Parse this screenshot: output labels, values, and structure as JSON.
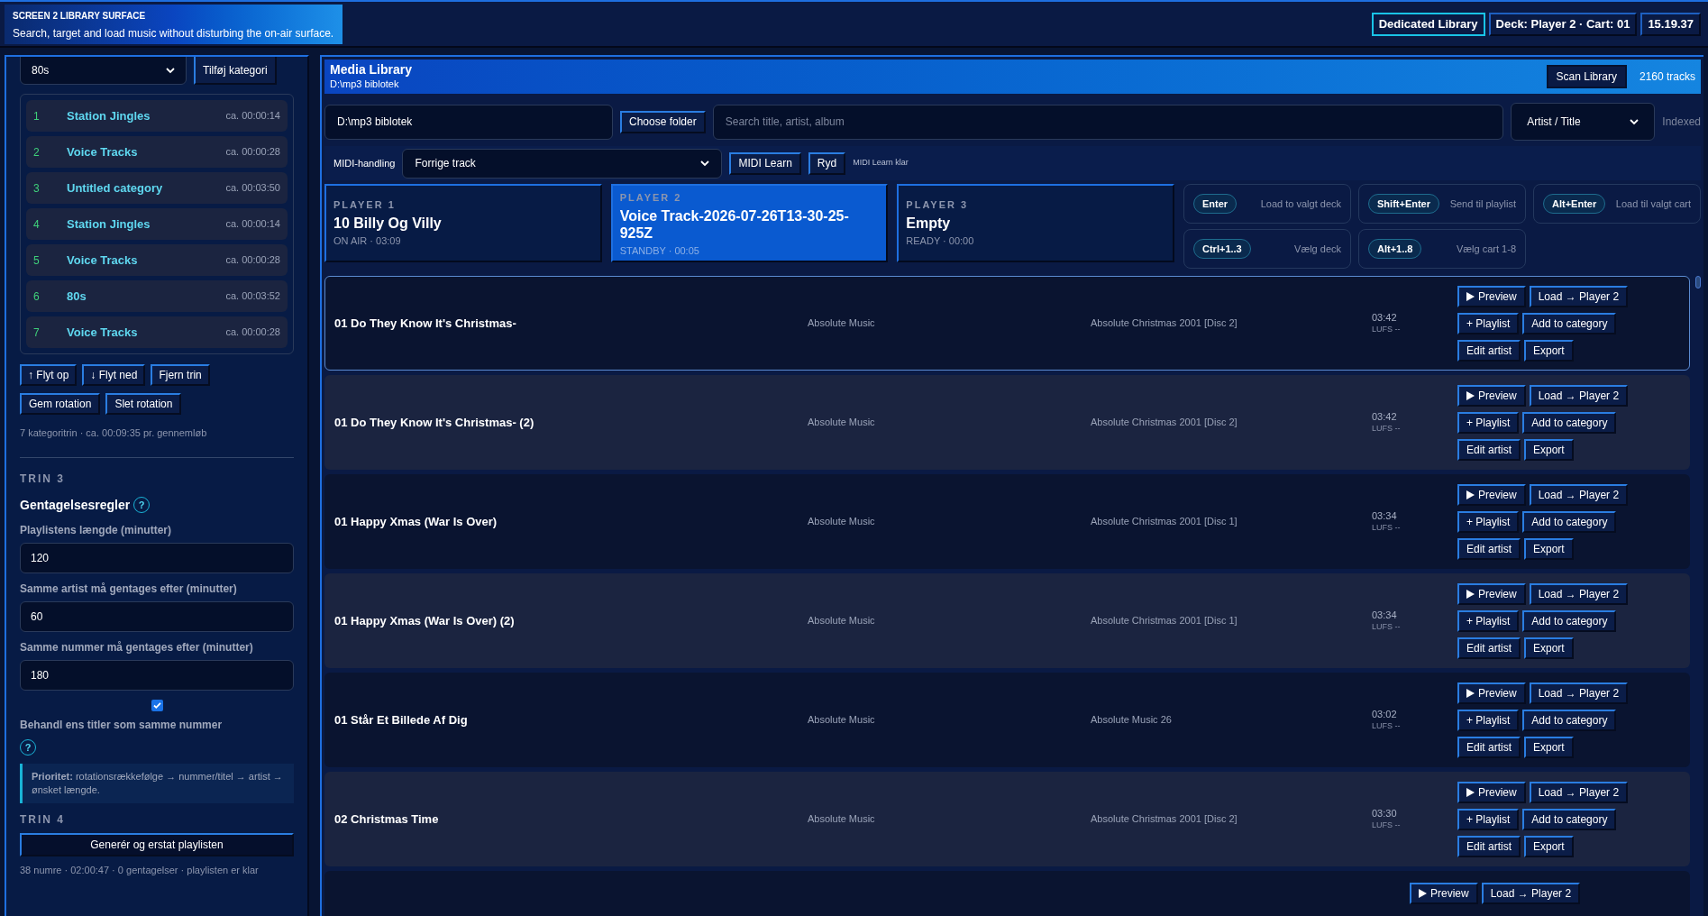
{
  "header": {
    "label": "SCREEN 2 LIBRARY SURFACE",
    "subtitle": "Search, target and load music without disturbing the on-air surface."
  },
  "badges": [
    {
      "text": "Dedicated Library",
      "kind": "accent"
    },
    {
      "text": "Deck: Player 2 · Cart: 01",
      "kind": "plain"
    },
    {
      "text": "15.19.37",
      "kind": "plain"
    }
  ],
  "sidebar": {
    "category_select": "80s",
    "add_category": "Tilføj kategori",
    "rotation": [
      {
        "number": "1",
        "name": "Station Jingles",
        "duration": "ca. 00:00:14"
      },
      {
        "number": "2",
        "name": "Voice Tracks",
        "duration": "ca. 00:00:28"
      },
      {
        "number": "3",
        "name": "Untitled category",
        "duration": "ca. 00:03:50"
      },
      {
        "number": "4",
        "name": "Station Jingles",
        "duration": "ca. 00:00:14"
      },
      {
        "number": "5",
        "name": "Voice Tracks",
        "duration": "ca. 00:00:28"
      },
      {
        "number": "6",
        "name": "80s",
        "duration": "ca. 00:03:52"
      },
      {
        "number": "7",
        "name": "Voice Tracks",
        "duration": "ca. 00:00:28"
      }
    ],
    "step_buttons": [
      "↑ Flyt op",
      "↓ Flyt ned",
      "Fjern trin"
    ],
    "rotation_buttons": [
      "Gem rotation",
      "Slet rotation"
    ],
    "summary": "7 kategoritrin · ca. 00:09:35 pr. gennemløb",
    "step3": "TRIN 3",
    "rules_heading": "Gentagelsesregler",
    "help": "?",
    "fields": [
      {
        "label": "Playlistens længde (minutter)",
        "value": "120"
      },
      {
        "label": "Samme artist må gentages efter (minutter)",
        "value": "60"
      },
      {
        "label": "Samme nummer må gentages efter (minutter)",
        "value": "180"
      }
    ],
    "same_titles": {
      "checked": true,
      "label": "Behandl ens titler som samme nummer",
      "help": "?"
    },
    "priority": "**Prioritet:** rotationsrækkefølge → nummer/titel → artist → ønsket længde.",
    "step4": "TRIN 4",
    "generate": "Generér og erstat playlisten",
    "result": "38 numre · 02:00:47 · 0 gentagelser · playlisten er klar"
  },
  "library": {
    "title": "Media Library",
    "path": "D:\\mp3 biblotek",
    "scan": "Scan Library",
    "count": "2160 tracks",
    "folder": "D:\\mp3 biblotek",
    "choose_folder": "Choose folder",
    "search_placeholder": "Search title, artist, album",
    "sort": "Artist / Title",
    "indexed": "Indexed",
    "midi_label": "MIDI-handling",
    "midi_action": "Forrige track",
    "midi_learn": "MIDI Learn",
    "midi_clear": "Ryd",
    "midi_status": "MIDI Learn klar",
    "players": [
      {
        "label": "PLAYER 1",
        "title": "10 Billy Og Villy",
        "status": "ON AIR · 03:09",
        "selected": false
      },
      {
        "label": "PLAYER 2",
        "title": "Voice Track-2026-07-26T13-30-25-925Z",
        "status": "STANDBY · 00:05",
        "selected": true
      },
      {
        "label": "PLAYER 3",
        "title": "Empty",
        "status": "READY · 00:00",
        "selected": false
      }
    ],
    "shortcuts": [
      {
        "key": "Enter",
        "text": "Load to valgt deck"
      },
      {
        "key": "Shift+Enter",
        "text": "Send til playlist"
      },
      {
        "key": "Alt+Enter",
        "text": "Load til valgt cart"
      },
      {
        "key": "Ctrl+1..3",
        "text": "Vælg deck"
      },
      {
        "key": "Alt+1..8",
        "text": "Vælg cart 1-8"
      }
    ],
    "tracks": [
      {
        "kind": "track",
        "selected": true,
        "title": "01 Do They Know It's Christmas-",
        "artist": "Absolute Music",
        "album": "Absolute Christmas 2001 [Disc 2]",
        "duration": "03:42",
        "lufs": "LUFS --",
        "actions": [
          "Preview",
          "Load → Player 2",
          "+ Playlist",
          "Add to category",
          "Edit artist",
          "Export"
        ]
      },
      {
        "kind": "track",
        "selected": false,
        "title": "01 Do They Know It's Christmas- (2)",
        "artist": "Absolute Music",
        "album": "Absolute Christmas 2001 [Disc 2]",
        "duration": "03:42",
        "lufs": "LUFS --",
        "actions": [
          "Preview",
          "Load → Player 2",
          "+ Playlist",
          "Add to category",
          "Edit artist",
          "Export"
        ]
      },
      {
        "kind": "track",
        "selected": false,
        "title": "01 Happy Xmas (War Is Over)",
        "artist": "Absolute Music",
        "album": "Absolute Christmas 2001 [Disc 1]",
        "duration": "03:34",
        "lufs": "LUFS --",
        "actions": [
          "Preview",
          "Load → Player 2",
          "+ Playlist",
          "Add to category",
          "Edit artist",
          "Export"
        ]
      },
      {
        "kind": "track",
        "selected": false,
        "title": "01 Happy Xmas (War Is Over) (2)",
        "artist": "Absolute Music",
        "album": "Absolute Christmas 2001 [Disc 1]",
        "duration": "03:34",
        "lufs": "LUFS --",
        "actions": [
          "Preview",
          "Load → Player 2",
          "+ Playlist",
          "Add to category",
          "Edit artist",
          "Export"
        ]
      },
      {
        "kind": "track",
        "selected": false,
        "title": "01 Står Et Billede Af Dig",
        "artist": "Absolute Music",
        "album": "Absolute Music 26",
        "duration": "03:02",
        "lufs": "LUFS --",
        "actions": [
          "Preview",
          "Load → Player 2",
          "+ Playlist",
          "Add to category",
          "Edit artist",
          "Export"
        ]
      },
      {
        "kind": "track",
        "selected": false,
        "title": "02 Christmas Time",
        "artist": "Absolute Music",
        "album": "Absolute Christmas 2001 [Disc 2]",
        "duration": "03:30",
        "lufs": "LUFS --",
        "actions": [
          "Preview",
          "Load → Player 2",
          "+ Playlist",
          "Add to category",
          "Edit artist",
          "Export"
        ]
      },
      {
        "kind": "partial",
        "selected": false,
        "actions": [
          "Preview",
          "Load → Player 2"
        ]
      }
    ]
  }
}
